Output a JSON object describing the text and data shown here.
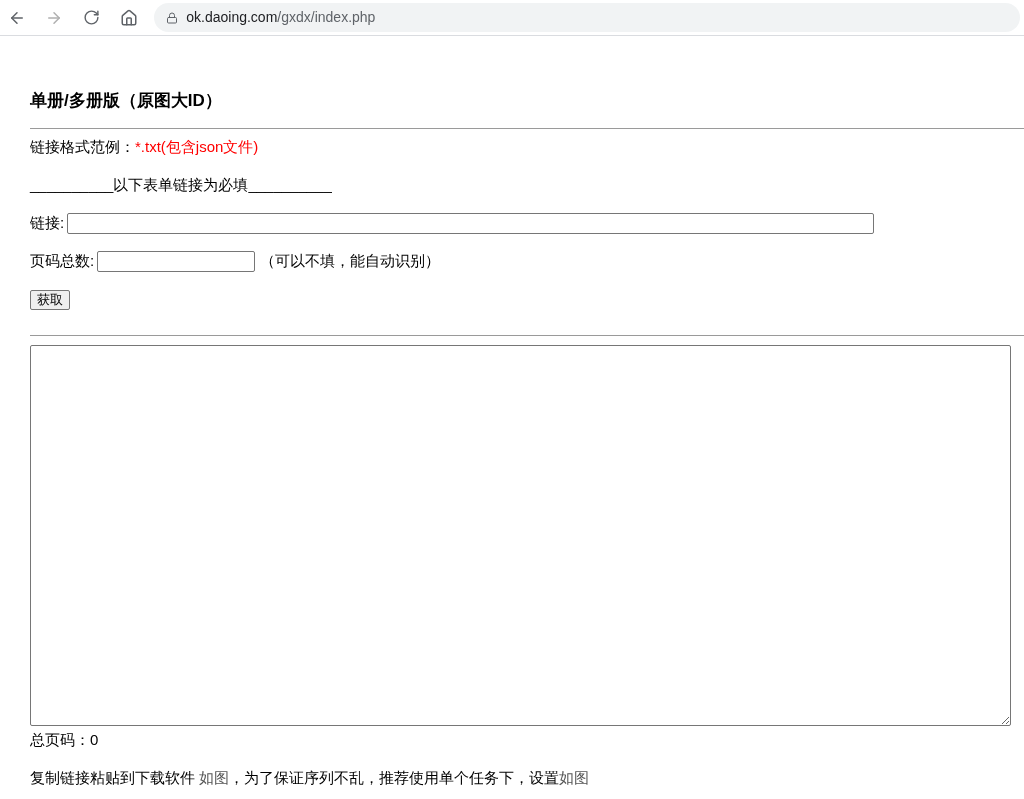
{
  "browser": {
    "back": {
      "disabled": false
    },
    "forward": {
      "disabled": true
    },
    "url": {
      "domain": "ok.daoing.com",
      "path": "/gxdx/index.php"
    }
  },
  "heading": "单册/多册版（原图大ID）",
  "format_hint": {
    "label": "链接格式范例：",
    "example": "*.txt(包含json文件)"
  },
  "required_note": "__________以下表单链接为必填__________",
  "fields": [
    {
      "kind": "wide",
      "label": "链接:"
    },
    {
      "kind": "short",
      "label": "页码总数:",
      "note": "（可以不填，能自动识别）"
    }
  ],
  "button": "获取",
  "total_pages": "总页码：0",
  "footer": [
    {
      "kind": "text",
      "text": "复制链接粘贴到下载软件 "
    },
    {
      "kind": "link",
      "text": "如图"
    },
    {
      "kind": "text",
      "text": "，为了保证序列不乱，推荐使用单个任务下，设置"
    },
    {
      "kind": "link",
      "text": "如图"
    }
  ]
}
